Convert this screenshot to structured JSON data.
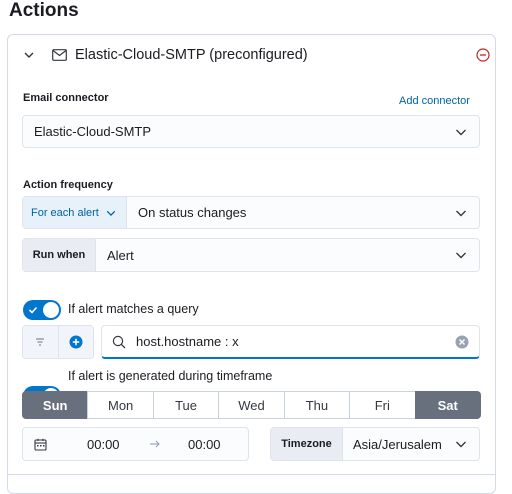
{
  "heading": "Actions",
  "action": {
    "title": "Elastic-Cloud-SMTP (preconfigured)",
    "connector_label": "Email connector",
    "add_connector": "Add connector",
    "connector_value": "Elastic-Cloud-SMTP",
    "frequency_label": "Action frequency",
    "frequency_prepend": "For each alert",
    "frequency_value": "On status changes",
    "run_when_prepend": "Run when",
    "run_when_value": "Alert",
    "query_toggle_label": "If alert matches a query",
    "query_toggle_on": true,
    "query_value": "host.hostname : x",
    "timeframe_toggle_label": "If alert is generated during timeframe",
    "timeframe_toggle_on": true,
    "days": [
      {
        "label": "Sun",
        "selected": true
      },
      {
        "label": "Mon",
        "selected": false
      },
      {
        "label": "Tue",
        "selected": false
      },
      {
        "label": "Wed",
        "selected": false
      },
      {
        "label": "Thu",
        "selected": false
      },
      {
        "label": "Fri",
        "selected": false
      },
      {
        "label": "Sat",
        "selected": true
      }
    ],
    "time_start": "00:00",
    "time_end": "00:00",
    "timezone_label": "Timezone",
    "timezone_value": "Asia/Jerusalem"
  },
  "colors": {
    "primary": "#0077cc",
    "danger": "#bd271e",
    "selected_day": "#69707d"
  }
}
